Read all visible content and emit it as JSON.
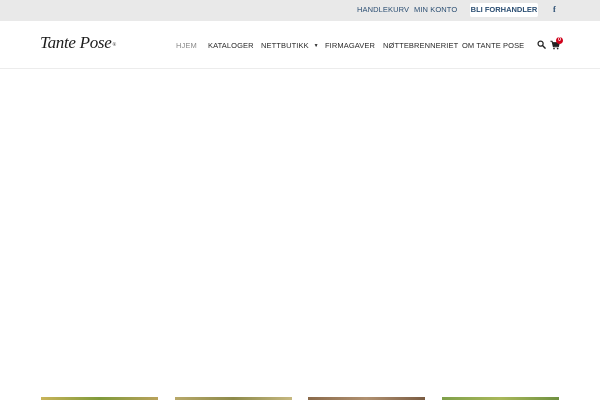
{
  "topbar": {
    "links": [
      "HANDLEKURV",
      "MIN KONTO"
    ],
    "cta": "BLI FORHANDLER",
    "social_icon": "facebook-icon"
  },
  "header": {
    "logo_text": "Tante Pose",
    "logo_mark": "®",
    "nav": [
      {
        "label": "HJEM",
        "active": true
      },
      {
        "label": "KATALOGER"
      },
      {
        "label": "NETTBUTIKK",
        "has_dropdown": true
      },
      {
        "label": "FIRMAGAVER"
      },
      {
        "label": "NØTTEBRENNERIET"
      },
      {
        "label": "OM TANTE POSE"
      }
    ],
    "icons": [
      "search-icon",
      "cart-icon"
    ],
    "cart_count": "0"
  },
  "colors": {
    "topbar_bg": "#e9e9e9",
    "link": "#2c4f73",
    "badge": "#d0021b"
  }
}
